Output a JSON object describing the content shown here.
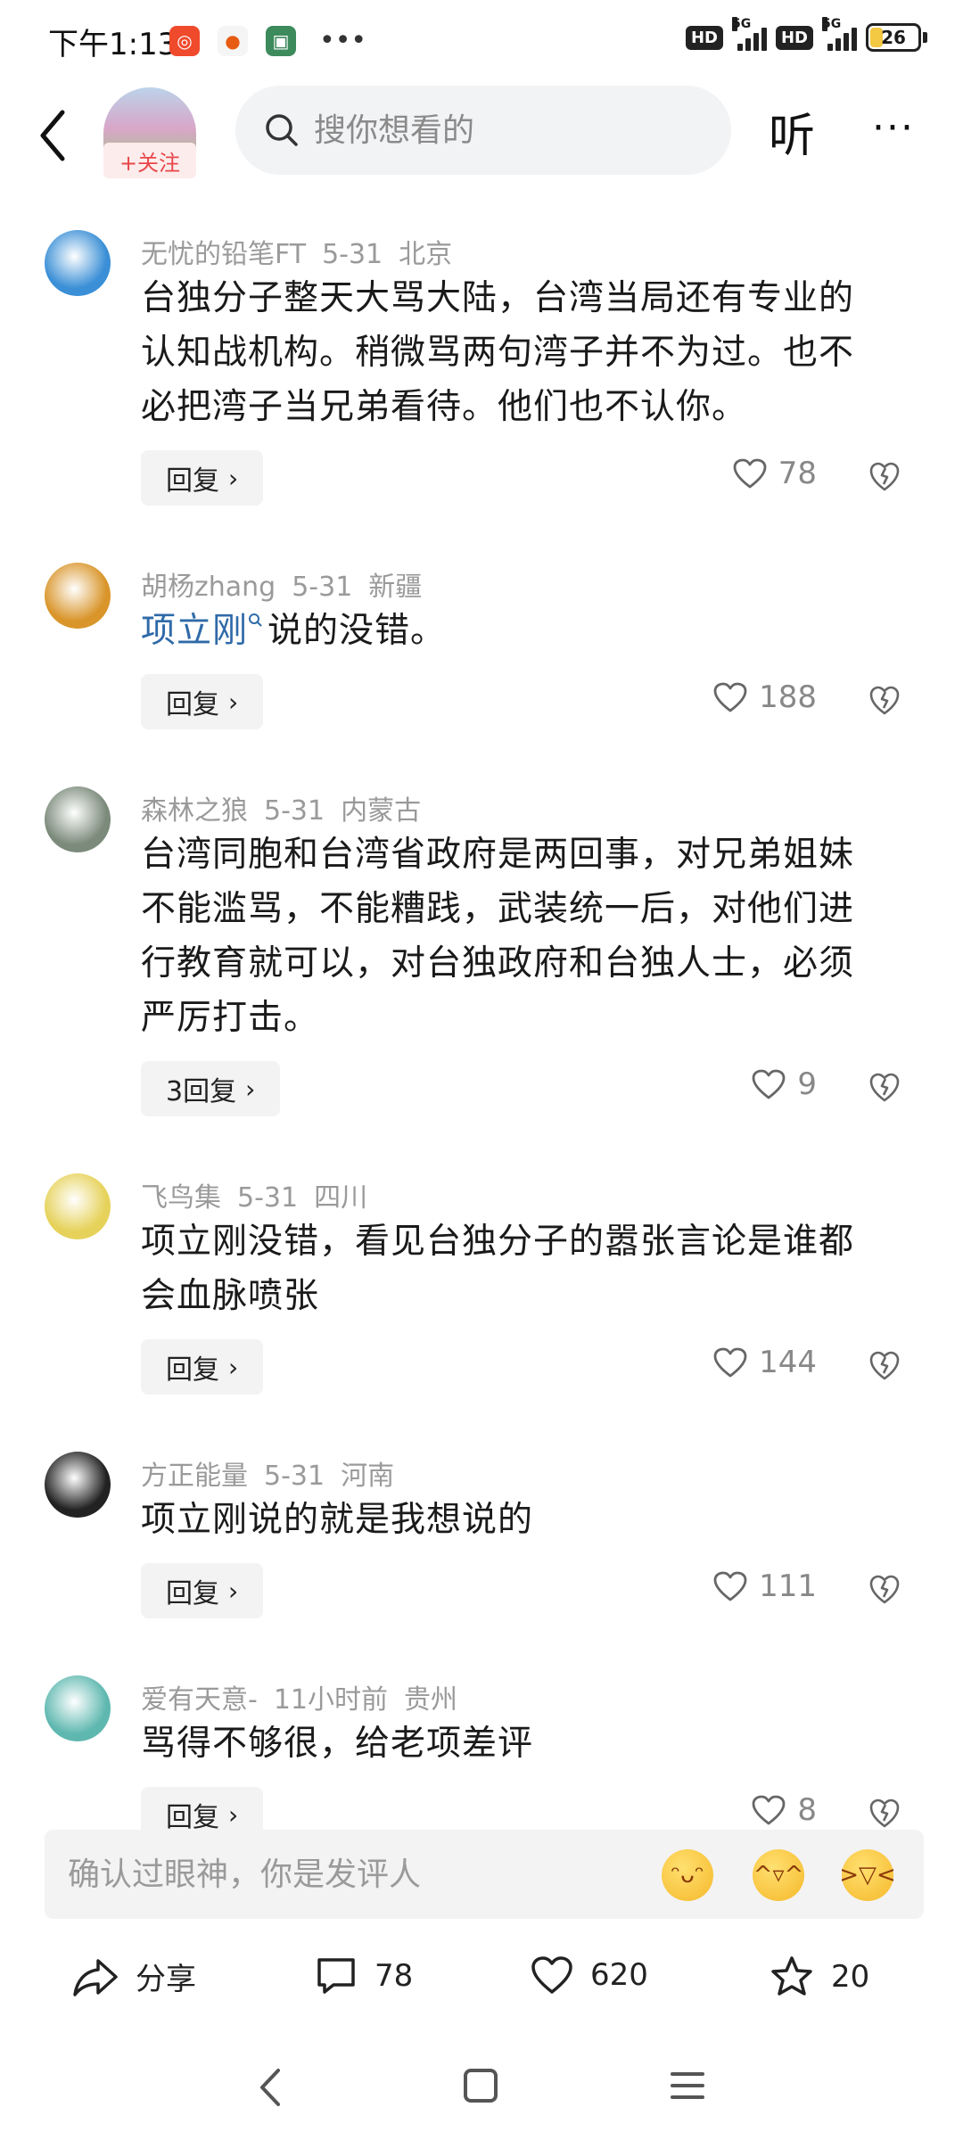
{
  "status_bar": {
    "time": "下午1:13",
    "network_left": "5G",
    "network_right": "5G",
    "battery": "26",
    "hd_label": "HD"
  },
  "header": {
    "follow_label": "+关注",
    "search_placeholder": "搜你想看的",
    "listen_label": "听",
    "more_label": "···"
  },
  "comments": [
    {
      "user": "无忧的铅笔FT",
      "date": "5-31",
      "location": "北京",
      "lines": [
        "台独分子整天大骂大陆，台湾当局还有专业的",
        "认知战机构。稍微骂两句湾子并不为过。也不",
        "必把湾子当兄弟看待。他们也不认你。"
      ],
      "reply_label": "回复",
      "likes": "78",
      "avatar_color": "#3a8fd6"
    },
    {
      "user": "胡杨zhang",
      "date": "5-31",
      "location": "新疆",
      "link_text": "项立刚",
      "text_after_link": "说的没错。",
      "reply_label": "回复",
      "likes": "188",
      "avatar_color": "#d9952a"
    },
    {
      "user": "森林之狼",
      "date": "5-31",
      "location": "内蒙古",
      "lines": [
        "台湾同胞和台湾省政府是两回事，对兄弟姐妹",
        "不能滥骂，不能糟践，武装统一后，对他们进",
        "行教育就可以，对台独政府和台独人士，必须",
        "严厉打击。"
      ],
      "reply_label": "3回复",
      "likes": "9",
      "avatar_color": "#7b8a7a"
    },
    {
      "user": "飞鸟集",
      "date": "5-31",
      "location": "四川",
      "lines": [
        "项立刚没错，看见台独分子的嚣张言论是谁都",
        "会血脉喷张"
      ],
      "reply_label": "回复",
      "likes": "144",
      "avatar_color": "#e6d25a"
    },
    {
      "user": "方正能量",
      "date": "5-31",
      "location": "河南",
      "lines": [
        "项立刚说的就是我想说的"
      ],
      "reply_label": "回复",
      "likes": "111",
      "avatar_color": "#222222"
    },
    {
      "user": "爱有天意-",
      "date": "11小时前",
      "location": "贵州",
      "lines": [
        "骂得不够很，给老项差评"
      ],
      "reply_label": "回复",
      "likes": "8",
      "avatar_color": "#5fb8b0"
    }
  ],
  "input_bar": {
    "placeholder": "确认过眼神，你是发评人"
  },
  "action_bar": {
    "share_label": "分享",
    "comments_count": "78",
    "likes_count": "620",
    "favorites_count": "20"
  }
}
